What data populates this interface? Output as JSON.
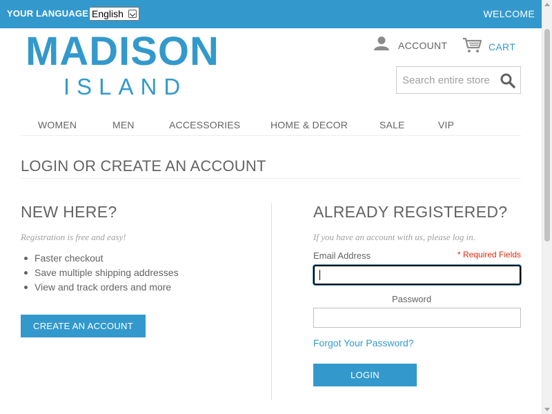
{
  "topbar": {
    "language_label": "YOUR LANGUAGE:",
    "language_selected": "English",
    "welcome": "WELCOME"
  },
  "logo": {
    "main": "MADISON",
    "sub": "ISLAND"
  },
  "header": {
    "account_label": "ACCOUNT",
    "cart_label": "CART",
    "search_placeholder": "Search entire store here..."
  },
  "nav": {
    "items": [
      {
        "label": "WOMEN"
      },
      {
        "label": "MEN"
      },
      {
        "label": "ACCESSORIES"
      },
      {
        "label": "HOME & DECOR"
      },
      {
        "label": "SALE"
      },
      {
        "label": "VIP"
      }
    ]
  },
  "page": {
    "title": "LOGIN OR CREATE AN ACCOUNT"
  },
  "new_customer": {
    "title": "NEW HERE?",
    "note": "Registration is free and easy!",
    "benefits": [
      "Faster checkout",
      "Save multiple shipping addresses",
      "View and track orders and more"
    ],
    "create_button": "CREATE AN ACCOUNT"
  },
  "login": {
    "title": "ALREADY REGISTERED?",
    "note": "If you have an account with us, please log in.",
    "email_label": "Email Address",
    "required_note": "* Required Fields",
    "email_value": "",
    "password_label": "Password",
    "password_value": "",
    "forgot_link": "Forgot Your Password?",
    "login_button": "LOGIN"
  },
  "colors": {
    "accent": "#3399cc",
    "text": "#636363",
    "required": "#df280a"
  }
}
